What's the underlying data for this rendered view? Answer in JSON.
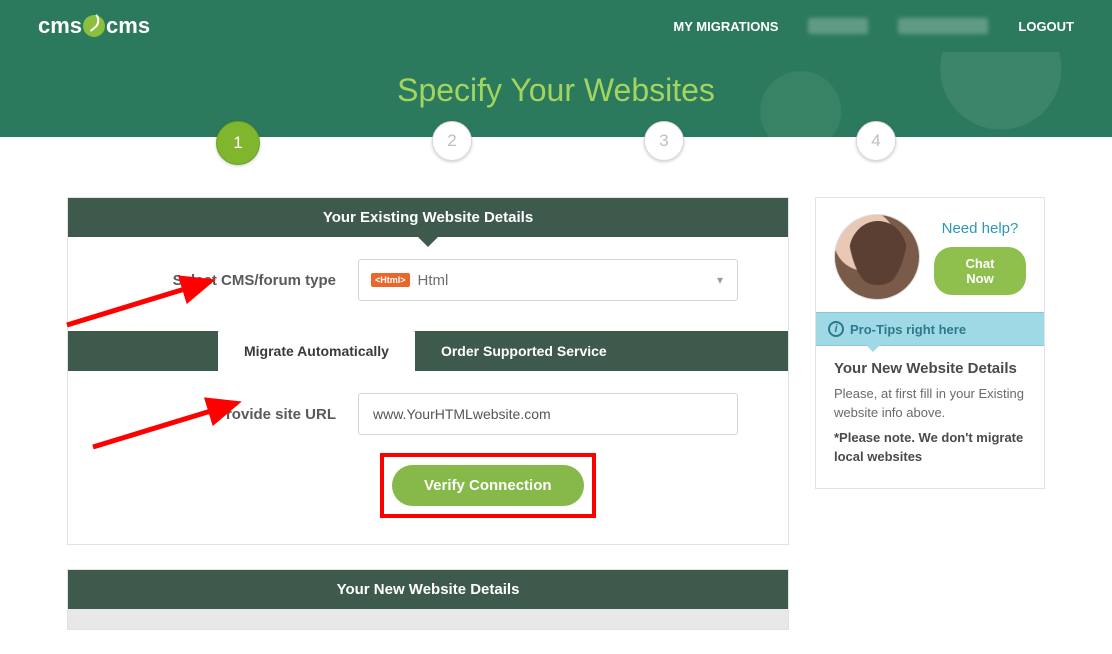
{
  "brand": {
    "part1": "cms",
    "part2": "cms"
  },
  "nav": {
    "my_migrations": "MY MIGRATIONS",
    "logout": "LOGOUT"
  },
  "hero": {
    "title": "Specify Your Websites"
  },
  "steps": {
    "s1": "1",
    "s2": "2",
    "s3": "3",
    "s4": "4"
  },
  "existing": {
    "header": "Your Existing Website Details",
    "select_label": "Select CMS/forum type",
    "type_badge": "<Html>",
    "type_value": "Html",
    "tab_auto": "Migrate Automatically",
    "tab_order": "Order Supported Service",
    "url_label": "Provide site URL",
    "url_value": "www.YourHTMLwebsite.com",
    "verify": "Verify Connection"
  },
  "new_panel": {
    "header": "Your New Website Details"
  },
  "side": {
    "need_help": "Need help?",
    "chat": "Chat Now",
    "protips": "Pro-Tips right here",
    "heading": "Your New Website Details",
    "line1": "Please, at first fill in your Existing website info above.",
    "line2": "*Please note. We don't migrate local websites"
  }
}
